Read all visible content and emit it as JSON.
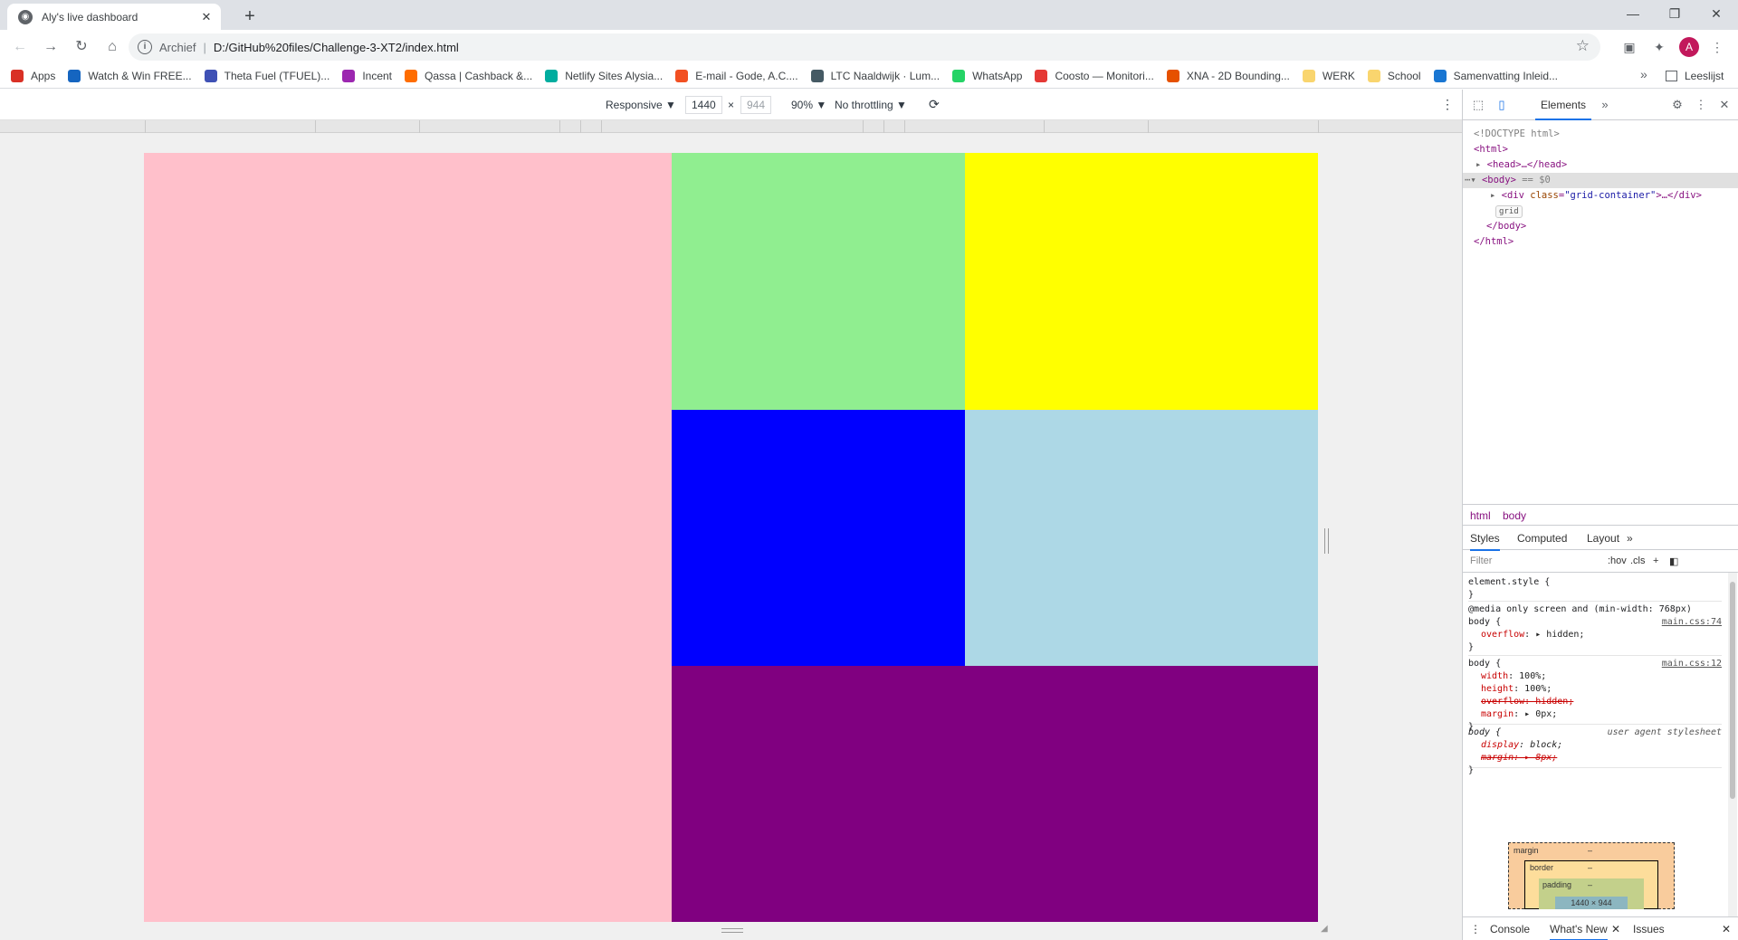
{
  "tab": {
    "title": "Aly's live dashboard",
    "close_glyph": "✕",
    "new_tab_glyph": "+"
  },
  "window": {
    "minimize": "—",
    "restore": "❐",
    "close": "✕"
  },
  "nav": {
    "back": "←",
    "forward": "→",
    "reload": "↻",
    "home": "⌂"
  },
  "omnibox": {
    "info_glyph": "i",
    "scheme_label": "Archief",
    "separator": "|",
    "url": "D:/GitHub%20files/Challenge-3-XT2/index.html",
    "star_glyph": "☆"
  },
  "profile": {
    "initial": "A"
  },
  "toolbar_icons": {
    "ext1": "▣",
    "puzzle": "✦",
    "menu": "⋮"
  },
  "bookmarks": [
    {
      "label": "Apps",
      "icon": "apps-grid-icon",
      "color": "#d93025"
    },
    {
      "label": "Watch & Win FREE...",
      "icon": "v-logo-icon",
      "color": "#1565c0"
    },
    {
      "label": "Theta Fuel (TFUEL)...",
      "icon": "coin-icon",
      "color": "#3f51b5"
    },
    {
      "label": "Incent",
      "icon": "incent-icon",
      "color": "#9c27b0"
    },
    {
      "label": "Qassa | Cashback &...",
      "icon": "qassa-icon",
      "color": "#ff6d00"
    },
    {
      "label": "Netlify Sites Alysia...",
      "icon": "netlify-icon",
      "color": "#00ad9f"
    },
    {
      "label": "E-mail - Gode, A.C....",
      "icon": "microsoft-icon",
      "color": "#f25022"
    },
    {
      "label": "LTC Naaldwijk · Lum...",
      "icon": "sun-icon",
      "color": "#455a64"
    },
    {
      "label": "WhatsApp",
      "icon": "whatsapp-icon",
      "color": "#25d366"
    },
    {
      "label": "Coosto — Monitori...",
      "icon": "coosto-icon",
      "color": "#e53935"
    },
    {
      "label": "XNA - 2D Bounding...",
      "icon": "xna-icon",
      "color": "#e65100"
    },
    {
      "label": "WERK",
      "icon": "folder-icon",
      "color": "#f9d56e"
    },
    {
      "label": "School",
      "icon": "folder-icon",
      "color": "#f9d56e"
    },
    {
      "label": "Samenvatting Inleid...",
      "icon": "s-logo-icon",
      "color": "#1976d2"
    }
  ],
  "bookmarks_more": "»",
  "reading_list": "Leeslijst",
  "device_toolbar": {
    "mode": "Responsive ▼",
    "width": "1440",
    "times": "×",
    "height": "944",
    "zoom": "90% ▼",
    "throttle": "No throttling ▼",
    "rotate_glyph": "⟳",
    "more_glyph": "⋮"
  },
  "grid_cells": [
    {
      "name": "pink",
      "color": "#ffc0cb"
    },
    {
      "name": "green",
      "color": "#90ee90"
    },
    {
      "name": "yellow",
      "color": "#ffff00"
    },
    {
      "name": "blue",
      "color": "#0000ff"
    },
    {
      "name": "lightblue",
      "color": "#add8e6"
    },
    {
      "name": "purple",
      "color": "#800080"
    }
  ],
  "devtools": {
    "tab_elements": "Elements",
    "more_tabs": "»",
    "dom": {
      "doctype": "<!DOCTYPE html>",
      "html_open": "<html>",
      "head": "<head>…</head>",
      "body_open": "<body>",
      "body_eq": "== $0",
      "div_open": "<div ",
      "div_attr": "class",
      "div_val": "\"grid-container\"",
      "div_close": ">…</div>",
      "grid_badge": "grid",
      "body_close": "</body>",
      "html_close": "</html>"
    },
    "breadcrumbs": [
      "html",
      "body"
    ],
    "subtabs": [
      "Styles",
      "Computed",
      "Layout",
      "»"
    ],
    "filter_placeholder": "Filter",
    "filter_hov": ":hov",
    "filter_cls": ".cls",
    "filter_plus": "+",
    "styles": {
      "element_style": "element.style {",
      "close": "}",
      "media": "@media only screen and (min-width: 768px)",
      "body_sel": "body {",
      "src1": "main.css:74",
      "src2": "main.css:12",
      "overflow_prop": "overflow",
      "overflow_val": "▸ hidden;",
      "width_prop": "width",
      "width_val": "100%;",
      "height_prop": "height",
      "height_val": "100%;",
      "overflow_struck": "overflow: hidden;",
      "margin_prop": "margin",
      "margin_val": "▸ 0px;",
      "ua_label": "user agent stylesheet",
      "display_prop": "display",
      "display_val": "block;",
      "margin_struck": "margin: ▸ 8px;"
    },
    "box_model": {
      "margin": "margin",
      "border": "border",
      "padding": "padding",
      "dash": "–",
      "content": "1440 × 944"
    },
    "drawer": {
      "console": "Console",
      "whats_new": "What's New",
      "whats_new_close": "✕",
      "issues": "Issues",
      "close": "✕"
    }
  }
}
